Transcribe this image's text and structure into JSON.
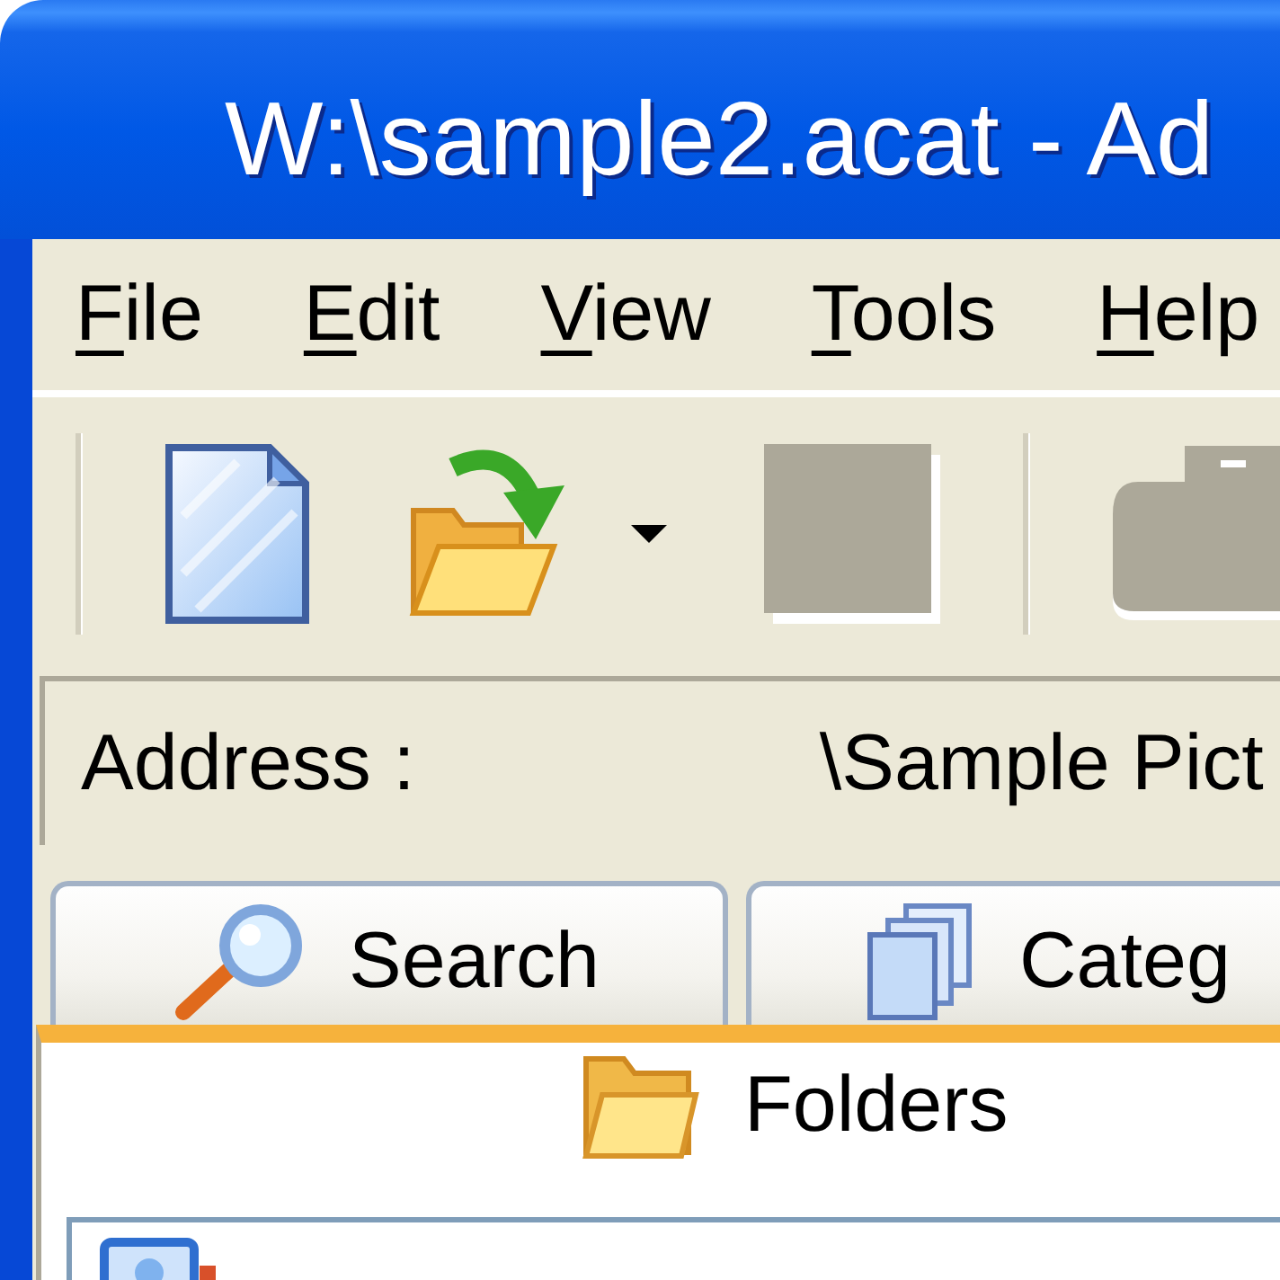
{
  "window": {
    "title": "W:\\sample2.acat - Ad"
  },
  "menu": [
    "File",
    "Edit",
    "View",
    "Tools",
    "Help"
  ],
  "toolbar": [
    {
      "kind": "separator"
    },
    {
      "kind": "document",
      "disabled": false,
      "dropdown": false
    },
    {
      "kind": "folder",
      "disabled": false,
      "dropdown": true
    },
    {
      "kind": "square",
      "disabled": true,
      "dropdown": false
    },
    {
      "kind": "separator"
    },
    {
      "kind": "printer",
      "disabled": true,
      "dropdown": false
    }
  ],
  "address": {
    "label": "Address :",
    "value": "\\Sample Pict"
  },
  "tabs": [
    {
      "label": "Search",
      "kind": "search",
      "selected": false
    },
    {
      "label": "Categ",
      "kind": "pages",
      "selected": false
    },
    {
      "label": "Folders",
      "kind": "folder",
      "selected": true
    }
  ]
}
